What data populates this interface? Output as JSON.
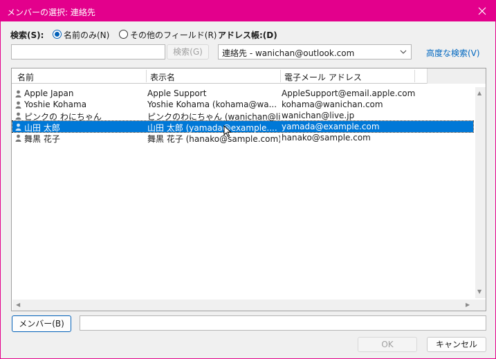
{
  "window": {
    "title": "メンバーの選択: 連絡先"
  },
  "search": {
    "label": "検索(S):",
    "option_name_only": "名前のみ(N)",
    "option_other_fields": "その他のフィールド(R)",
    "input_value": "",
    "search_button": "検索(G)"
  },
  "addressbook": {
    "label": "アドレス帳:(D)",
    "selected": "連絡先 - wanichan@outlook.com",
    "advanced_search": "高度な検索(V)"
  },
  "list": {
    "columns": [
      "名前",
      "表示名",
      "電子メール アドレス"
    ],
    "rows": [
      {
        "name": "Apple Japan",
        "display": "Apple Support",
        "email": "AppleSupport@email.apple.com"
      },
      {
        "name": "Yoshie Kohama",
        "display": "Yoshie Kohama (kohama@wa...",
        "email": "kohama@wanichan.com"
      },
      {
        "name": "ピンクの わにちゃん",
        "display": "ピンクのわにちゃん (wanichan@live...",
        "email": "wanichan@live.jp"
      },
      {
        "name": "山田 太郎",
        "display": "山田 太郎 (yamada@example....",
        "email": "yamada@example.com",
        "selected": true
      },
      {
        "name": "舞黒 花子",
        "display": "舞黒 花子 (hanako@sample.com)",
        "email": "hanako@sample.com"
      }
    ]
  },
  "members": {
    "button": "メンバー(B)",
    "value": ""
  },
  "footer": {
    "ok": "OK",
    "cancel": "キャンセル"
  },
  "colors": {
    "title_bar": "#e3008c",
    "selection": "#0078d7",
    "link": "#0067c0",
    "accent": "#005fb8"
  }
}
